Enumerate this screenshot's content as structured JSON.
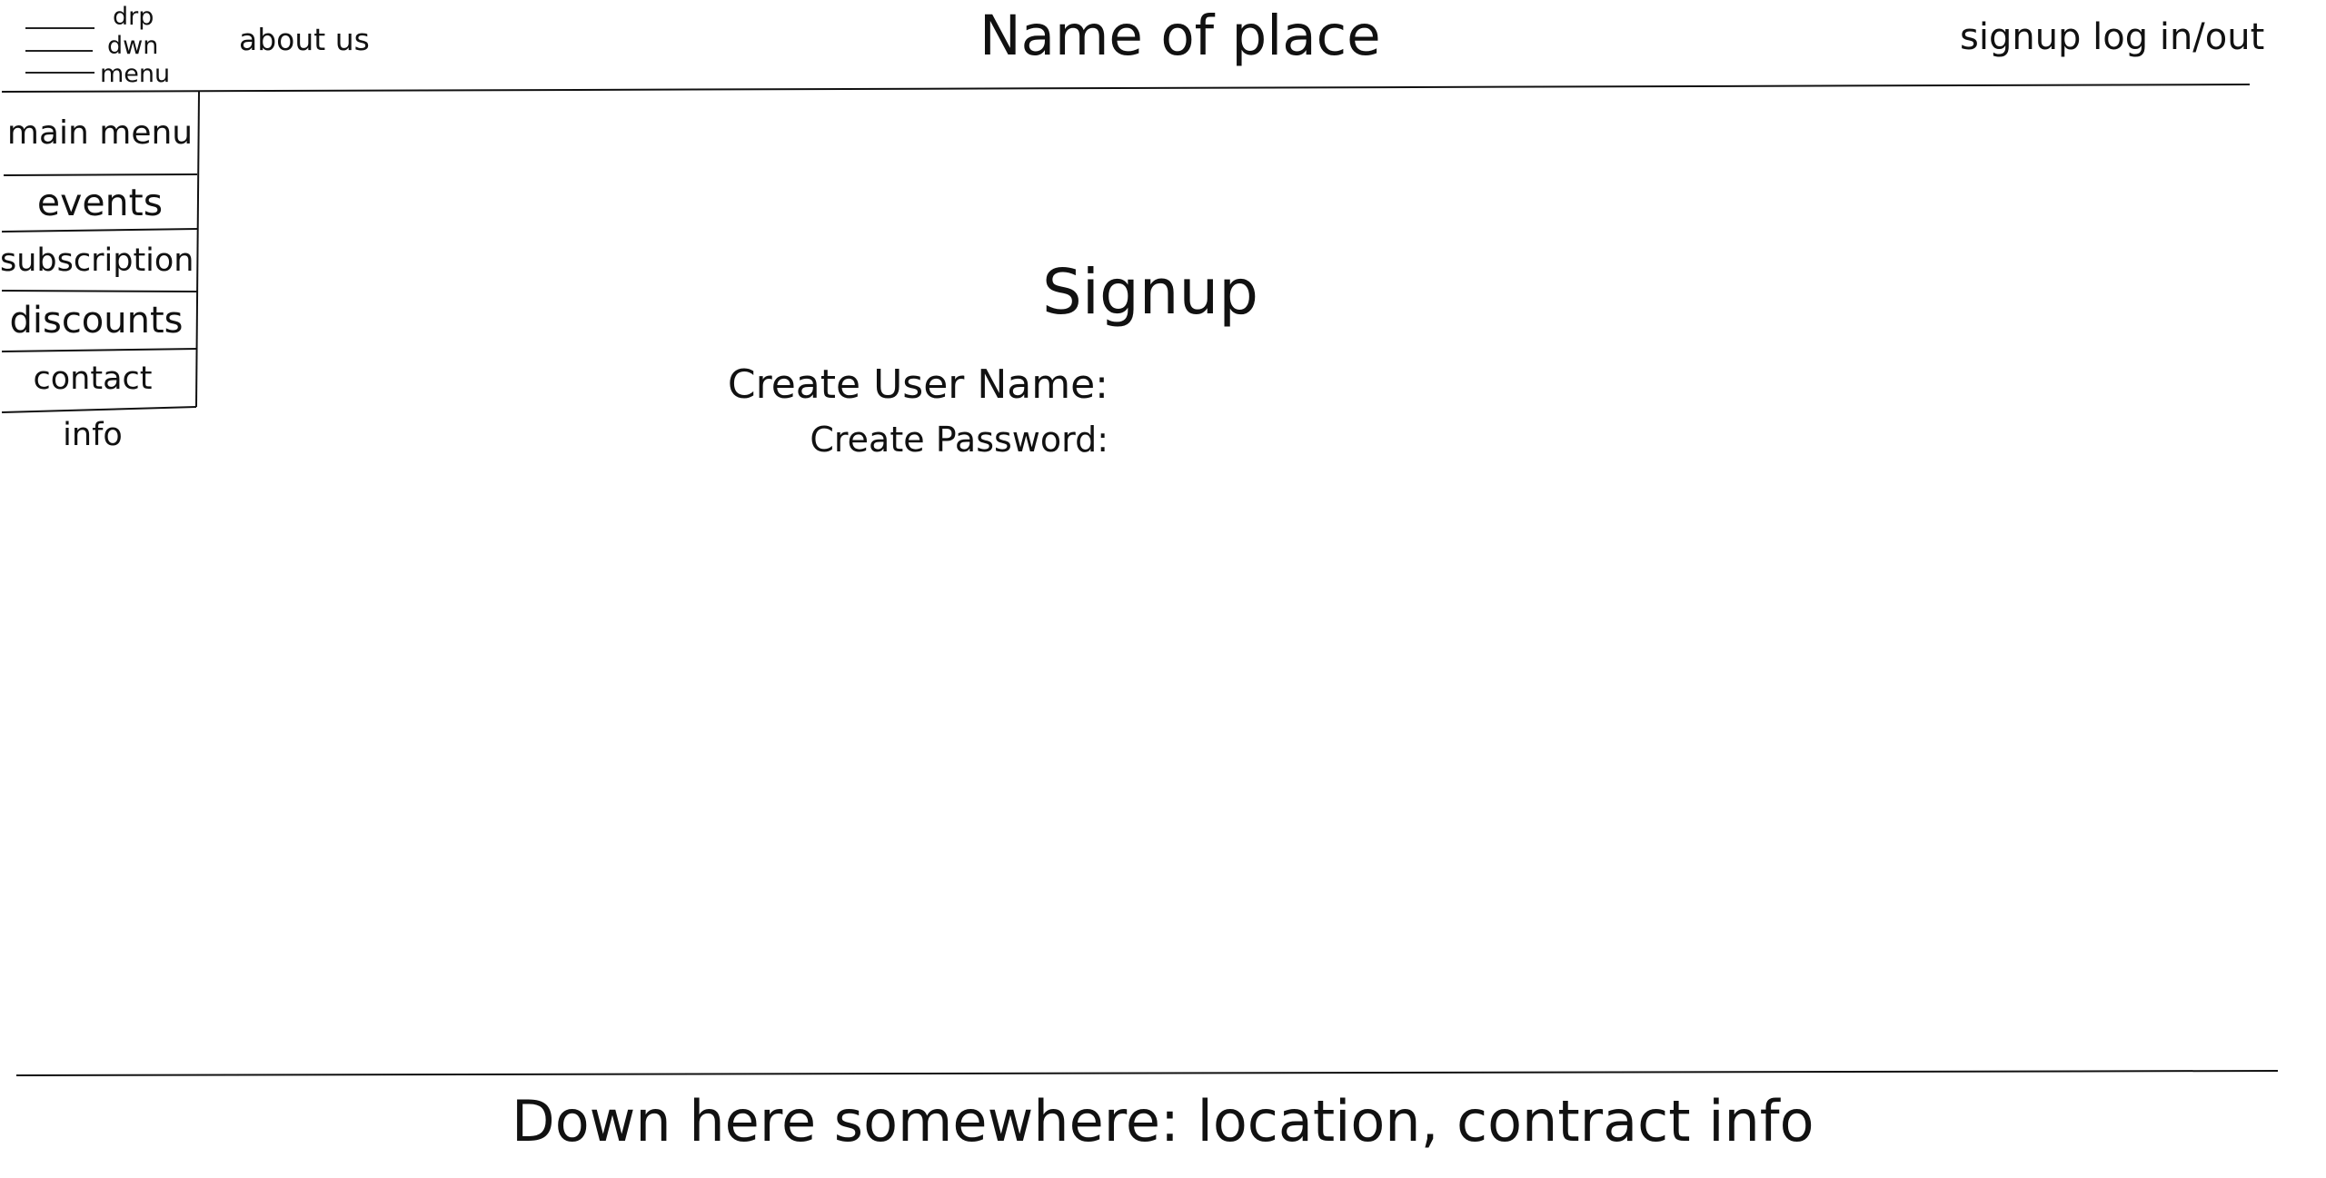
{
  "header": {
    "dropdown_menu": {
      "icon": "hamburger-icon",
      "label_line1": "drp",
      "label_line2": "dwn",
      "label_line3": "menu"
    },
    "about_link": "about us",
    "site_title": "Name of place",
    "auth_links": "signup log in/out"
  },
  "sidebar": {
    "items": [
      {
        "label": "main menu"
      },
      {
        "label": "events"
      },
      {
        "label": "subscription"
      },
      {
        "label": "discounts"
      },
      {
        "label": "contact info"
      }
    ]
  },
  "main": {
    "heading": "Signup",
    "username_label": "Create User Name:",
    "username_value": "",
    "password_label": "Create Password:",
    "password_value": ""
  },
  "footer": {
    "text": "Down here somewhere: location, contract info"
  },
  "colors": {
    "background": "#ffffff",
    "ink": "#111111"
  }
}
